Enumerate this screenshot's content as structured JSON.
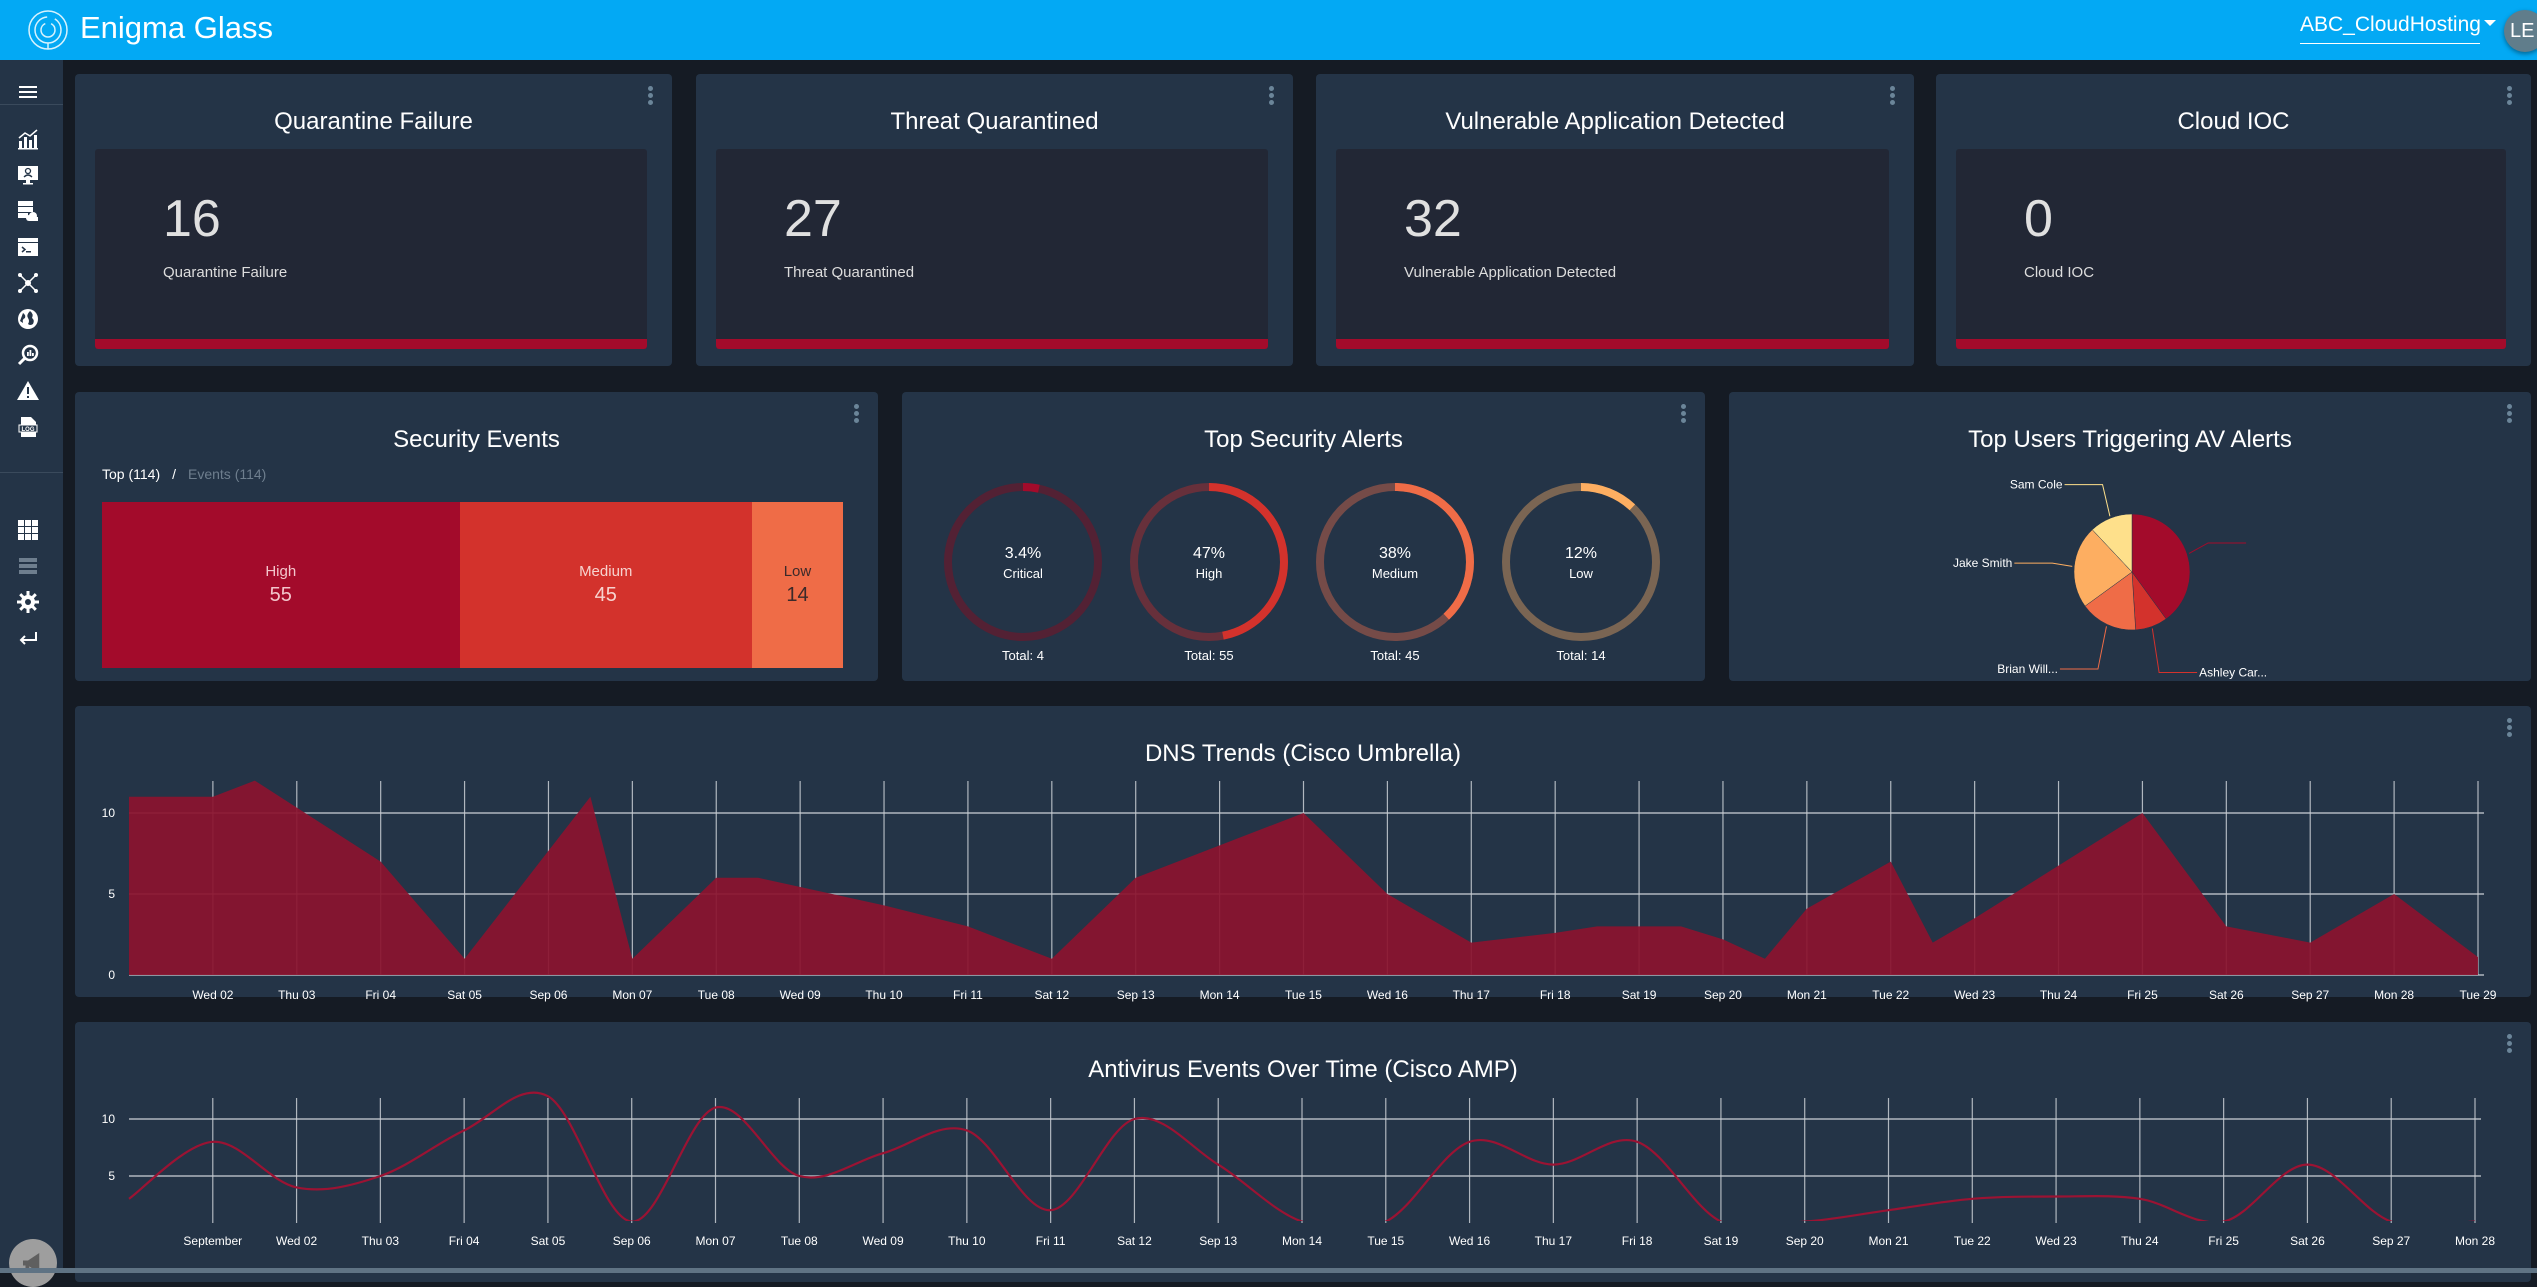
{
  "app": {
    "title": "Enigma Glass",
    "logo_icon": "maze-logo-icon"
  },
  "header": {
    "tenant": "ABC_CloudHosting",
    "avatar_initials": "LE"
  },
  "colors": {
    "header": "#03a9f4",
    "panel": "#243447",
    "background": "#151b24",
    "kpi_bar": "#a30b2b",
    "dns_fill": "#8b132e",
    "av_line": "#9b1333"
  },
  "sidebar": {
    "items": [
      {
        "icon": "menu-icon"
      },
      {
        "icon": "analytics-chart-icon"
      },
      {
        "icon": "monitor-user-icon"
      },
      {
        "icon": "server-cloud-icon"
      },
      {
        "icon": "terminal-icon"
      },
      {
        "icon": "network-nodes-icon"
      },
      {
        "icon": "globe-icon"
      },
      {
        "icon": "search-chart-icon"
      },
      {
        "icon": "warning-icon"
      },
      {
        "icon": "log-file-icon"
      },
      {
        "icon": "apps-grid-icon"
      },
      {
        "icon": "list-icon"
      },
      {
        "icon": "gear-icon"
      },
      {
        "icon": "logout-arrow-icon"
      }
    ],
    "notify_icon": "megaphone-icon"
  },
  "kpis": [
    {
      "title": "Quarantine Failure",
      "value": "16",
      "label": "Quarantine Failure"
    },
    {
      "title": "Threat Quarantined",
      "value": "27",
      "label": "Threat Quarantined"
    },
    {
      "title": "Vulnerable Application Detected",
      "value": "32",
      "label": "Vulnerable Application Detected"
    },
    {
      "title": "Cloud IOC",
      "value": "0",
      "label": "Cloud IOC"
    }
  ],
  "security_events": {
    "title": "Security Events",
    "tab_active": "Top (114)",
    "tab_sep": "/",
    "tab_inactive": "Events (114)",
    "cells": [
      {
        "label": "High",
        "value": 55,
        "color": "#a30b2b",
        "text_color": "#f3c6cc"
      },
      {
        "label": "Medium",
        "value": 45,
        "color": "#d3322c",
        "text_color": "#f7d3cf"
      },
      {
        "label": "Low",
        "value": 14,
        "color": "#ef6c47",
        "text_color": "#3b2a2a"
      }
    ]
  },
  "top_alerts": {
    "title": "Top Security Alerts",
    "items": [
      {
        "pct_label": "3.4%",
        "category": "Critical",
        "total": "Total: 4",
        "fraction": 0.034,
        "color": "#a30b2b",
        "track": "#532134"
      },
      {
        "pct_label": "47%",
        "category": "High",
        "total": "Total: 55",
        "fraction": 0.47,
        "color": "#d3322c",
        "track": "#67303b"
      },
      {
        "pct_label": "38%",
        "category": "Medium",
        "total": "Total: 45",
        "fraction": 0.38,
        "color": "#ef6c47",
        "track": "#754b48"
      },
      {
        "pct_label": "12%",
        "category": "Low",
        "total": "Total: 14",
        "fraction": 0.12,
        "color": "#fdae61",
        "track": "#7a6553"
      }
    ]
  },
  "top_users": {
    "title": "Top Users Triggering AV Alerts",
    "chart_data": {
      "type": "pie",
      "title": "Top Users Triggering AV Alerts",
      "slices": [
        {
          "label": "",
          "value": 40,
          "color": "#a30b2b"
        },
        {
          "label": "Ashley Car...",
          "value": 9,
          "color": "#d3322c"
        },
        {
          "label": "Brian Will...",
          "value": 16,
          "color": "#ef6c47"
        },
        {
          "label": "Jake Smith",
          "value": 23,
          "color": "#fdae61"
        },
        {
          "label": "Sam Cole",
          "value": 12,
          "color": "#fee08b"
        }
      ]
    }
  },
  "chart_data": [
    {
      "type": "area",
      "title": "DNS Trends (Cisco Umbrella)",
      "x_ticks": [
        "Wed 02",
        "Thu 03",
        "Fri 04",
        "Sat 05",
        "Sep 06",
        "Mon 07",
        "Tue 08",
        "Wed 09",
        "Thu 10",
        "Fri 11",
        "Sat 12",
        "Sep 13",
        "Mon 14",
        "Tue 15",
        "Wed 16",
        "Thu 17",
        "Fri 18",
        "Sat 19",
        "Sep 20",
        "Mon 21",
        "Tue 22",
        "Wed 23",
        "Thu 24",
        "Fri 25",
        "Sat 26",
        "Sep 27",
        "Mon 28",
        "Tue 29"
      ],
      "x_tick_days": [
        1,
        2,
        3,
        4,
        5,
        6,
        7,
        8,
        9,
        10,
        11,
        12,
        13,
        14,
        15,
        16,
        17,
        18,
        19,
        20,
        21,
        22,
        23,
        24,
        25,
        26,
        27,
        28
      ],
      "x_unit": "day of September offset from Sep 01",
      "points": [
        [
          0,
          11
        ],
        [
          1,
          11
        ],
        [
          1.5,
          12
        ],
        [
          3,
          7
        ],
        [
          4,
          1
        ],
        [
          5.5,
          11
        ],
        [
          6,
          1
        ],
        [
          7,
          6
        ],
        [
          7.5,
          6
        ],
        [
          9,
          4.3
        ],
        [
          10,
          3
        ],
        [
          11,
          1
        ],
        [
          12,
          6
        ],
        [
          13,
          8
        ],
        [
          14,
          10
        ],
        [
          15,
          5
        ],
        [
          16,
          2
        ],
        [
          17,
          2.6
        ],
        [
          17.5,
          3
        ],
        [
          18.5,
          3
        ],
        [
          19,
          2.2
        ],
        [
          19.5,
          1
        ],
        [
          20,
          4.1
        ],
        [
          21,
          7
        ],
        [
          21.5,
          2
        ],
        [
          22,
          3.5
        ],
        [
          24,
          10
        ],
        [
          25,
          3
        ],
        [
          26,
          2
        ],
        [
          27,
          5
        ],
        [
          28,
          1.1
        ]
      ],
      "y_ticks": [
        0,
        5,
        10
      ],
      "ylim": [
        0,
        12
      ],
      "xlim": [
        0,
        28
      ],
      "grid": true
    },
    {
      "type": "line",
      "title": "Antivirus Events Over Time (Cisco AMP)",
      "x_ticks": [
        "September",
        "Wed 02",
        "Thu 03",
        "Fri 04",
        "Sat 05",
        "Sep 06",
        "Mon 07",
        "Tue 08",
        "Wed 09",
        "Thu 10",
        "Fri 11",
        "Sat 12",
        "Sep 13",
        "Mon 14",
        "Tue 15",
        "Wed 16",
        "Thu 17",
        "Fri 18",
        "Sat 19",
        "Sep 20",
        "Mon 21",
        "Tue 22",
        "Wed 23",
        "Thu 24",
        "Fri 25",
        "Sat 26",
        "Sep 27",
        "Mon 28"
      ],
      "x_tick_days": [
        1,
        2,
        3,
        4,
        5,
        6,
        7,
        8,
        9,
        10,
        11,
        12,
        13,
        14,
        15,
        16,
        17,
        18,
        19,
        20,
        21,
        22,
        23,
        24,
        25,
        26,
        27,
        28
      ],
      "x_unit": "day of September (0 = Aug 31)",
      "points": [
        [
          0,
          3
        ],
        [
          1,
          8
        ],
        [
          2,
          4
        ],
        [
          3,
          5
        ],
        [
          4,
          9
        ],
        [
          5,
          12
        ],
        [
          6,
          1
        ],
        [
          7,
          11
        ],
        [
          8,
          5
        ],
        [
          9,
          7
        ],
        [
          10,
          9
        ],
        [
          11,
          2
        ],
        [
          12,
          10
        ],
        [
          13,
          6
        ],
        [
          14,
          1
        ],
        [
          15,
          1
        ],
        [
          16,
          8
        ],
        [
          17,
          6
        ],
        [
          18,
          8
        ],
        [
          19,
          1
        ],
        [
          20,
          1
        ],
        [
          21,
          2
        ],
        [
          22,
          3
        ],
        [
          23,
          3.2
        ],
        [
          24,
          3
        ],
        [
          25,
          1
        ],
        [
          26,
          6
        ],
        [
          27,
          1
        ],
        [
          28,
          1
        ]
      ],
      "y_ticks": [
        5,
        10
      ],
      "ylim": [
        1.2,
        12.5
      ],
      "xlim": [
        0,
        28
      ],
      "grid": true,
      "smooth": true
    }
  ]
}
